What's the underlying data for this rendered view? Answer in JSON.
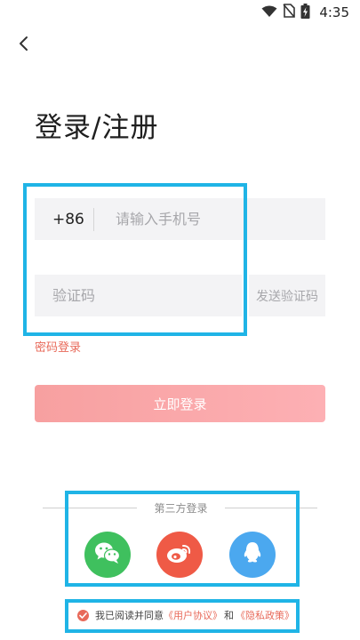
{
  "status_bar": {
    "time": "4:35"
  },
  "header": {
    "back_icon": "chevron-left-icon"
  },
  "title": "登录/注册",
  "form": {
    "country_code": "+86",
    "phone_placeholder": "请输入手机号",
    "code_placeholder": "验证码",
    "send_code_label": "发送验证码",
    "password_login_label": "密码登录",
    "login_button_label": "立即登录"
  },
  "third_party": {
    "label": "第三方登录",
    "providers": [
      {
        "name": "wechat",
        "icon": "wechat-icon",
        "color": "#3fc05e"
      },
      {
        "name": "weibo",
        "icon": "weibo-icon",
        "color": "#ef5a46"
      },
      {
        "name": "qq",
        "icon": "qq-icon",
        "color": "#4ba8ef"
      }
    ]
  },
  "agreement": {
    "prefix": "我已阅读并同意",
    "user_agreement": "《用户协议》",
    "and": "和",
    "privacy_policy": "《隐私政策》",
    "checked": true
  },
  "colors": {
    "accent": "#e86a5a",
    "highlight_border": "#1fb4e6",
    "input_bg": "#f3f3f5"
  }
}
